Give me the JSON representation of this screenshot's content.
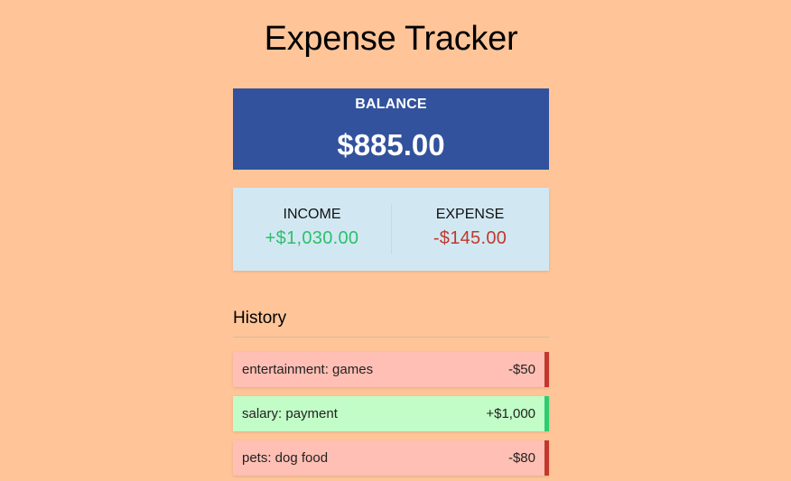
{
  "title": "Expense Tracker",
  "balance": {
    "label": "BALANCE",
    "amount": "$885.00"
  },
  "income": {
    "label": "INCOME",
    "amount": "+$1,030.00"
  },
  "expense": {
    "label": "EXPENSE",
    "amount": "-$145.00"
  },
  "history": {
    "title": "History",
    "items": [
      {
        "text": "entertainment: games",
        "amount": "-$50",
        "type": "minus"
      },
      {
        "text": "salary: payment",
        "amount": "+$1,000",
        "type": "plus"
      },
      {
        "text": "pets: dog food",
        "amount": "-$80",
        "type": "minus"
      }
    ]
  },
  "colors": {
    "page_background": "#ffc599",
    "balance_card": "#32529d",
    "income": "#2ebf6a",
    "expense": "#c0392b",
    "plus_item": "#c2fcc7",
    "minus_item": "#ffbfb4"
  }
}
